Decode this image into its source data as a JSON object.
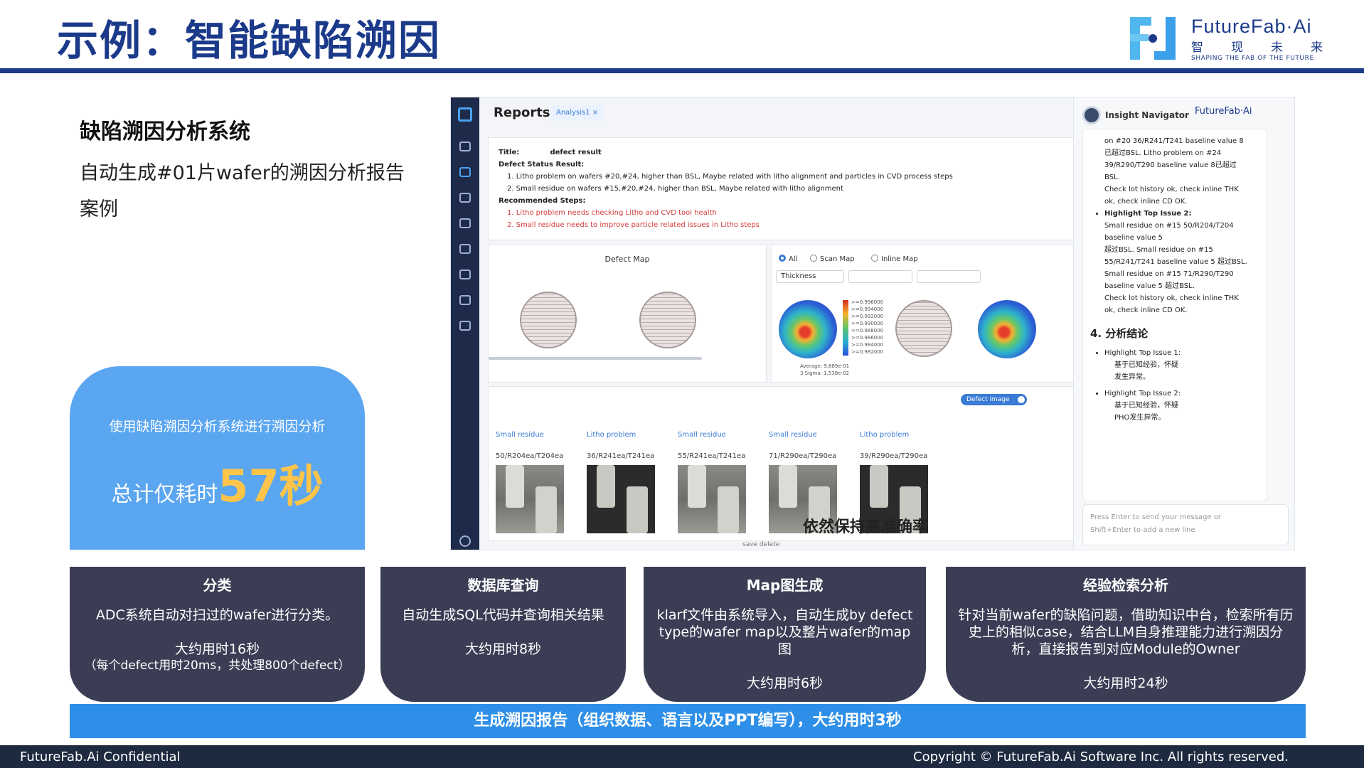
{
  "slide": {
    "title": "示例：智能缺陷溯因",
    "system_title": "缺陷溯因分析系统",
    "system_desc": "自动生成#01片wafer的溯因分析报告案例"
  },
  "logo": {
    "name": "FutureFab·Ai",
    "cn": [
      "智",
      "现",
      "未",
      "来"
    ],
    "tagline": "SHAPING THE FAB OF THE FUTURE"
  },
  "highlight": {
    "line1": "使用缺陷溯因分析系统进行溯因分析",
    "prefix": "总计仅耗时",
    "value": "57秒"
  },
  "app": {
    "title": "Reports",
    "tab": "Analysis1 ×",
    "report": {
      "title_label": "Title:",
      "title_value": "defect result",
      "status_header": "Defect Status Result:",
      "status_items": [
        "1. Litho problem on wafers #20,#24, higher than BSL, Maybe related with litho alignment and particles in CVD process steps",
        "2. Small residue on wafers #15,#20,#24, higher than BSL, Maybe related with litho alignment"
      ],
      "steps_header": "Recommended Steps:",
      "steps_items": [
        "1. Litho problem needs checking Litho and CVD tool health",
        "2. Small residue needs to improve particle related issues in Litho steps"
      ]
    },
    "defect_map_title": "Defect Map",
    "map_options": [
      "All",
      "Scan Map",
      "Inline Map"
    ],
    "thickness_select": "Thickness",
    "colorbar_labels": [
      ">=0.996000",
      ">=0.994000",
      ">=0.992000",
      ">=0.990000",
      ">=0.988000",
      ">=0.986000",
      ">=0.984000",
      ">=0.982000"
    ],
    "stats": [
      "Average: 9.889e-01",
      "3 Sigma: 1.538e-02"
    ],
    "defect_toggle": "Defect image",
    "defects": [
      {
        "type": "Small residue",
        "code": "50/R204ea/T204ea"
      },
      {
        "type": "Litho problem",
        "code": "36/R241ea/T241ea"
      },
      {
        "type": "Small residue",
        "code": "55/R241ea/T241ea"
      },
      {
        "type": "Small residue",
        "code": "71/R290ea/T290ea"
      },
      {
        "type": "Litho problem",
        "code": "39/R290ea/T290ea"
      }
    ],
    "overlay_caption": "依然保持高准确率",
    "actions": "save    delete",
    "navigator": {
      "title": "Insight Navigator",
      "logo": "FutureFab·Ai",
      "pre_lines": [
        "on #20 36/R241/T241 baseline value 8",
        "已超过BSL. Litho problem on #24",
        "39/R290/T290 baseline value 8已超过",
        "BSL.",
        "Check lot history ok, check inline THK",
        "ok, check inline CD OK."
      ],
      "issue2_label": "Highlight Top Issue 2:",
      "issue2_lines": [
        "Small residue on #15 50/R204/T204 baseline value 5",
        "超过BSL. Small residue on #15",
        "55/R241/T241 baseline value 5 超过BSL.",
        "Small residue on #15 71/R290/T290",
        "baseline value 5 超过BSL.",
        "Check lot history ok, check inline THK",
        "ok, check inline CD OK."
      ],
      "conclusion": "4. 分析结论",
      "c1": "Highlight Top Issue 1:",
      "c1_sub": [
        "基于已知经验，怀疑",
        "发生异常。"
      ],
      "c2": "Highlight Top Issue 2:",
      "c2_sub": [
        "基于已知经验，怀疑",
        "PHO发生异常。"
      ],
      "input_placeholder": [
        "Press Enter to send your message or",
        "Shift+Enter to add a new line"
      ]
    }
  },
  "steps": [
    {
      "title": "分类",
      "desc": "ADC系统自动对扫过的wafer进行分类。",
      "time": "大约用时16秒",
      "note": "（每个defect用时20ms，共处理800个defect）"
    },
    {
      "title": "数据库查询",
      "desc": "自动生成SQL代码并查询相关结果",
      "time": "大约用时8秒",
      "note": ""
    },
    {
      "title": "Map图生成",
      "desc": "klarf文件由系统导入，自动生成by defect type的wafer map以及整片wafer的map图",
      "time": "大约用时6秒",
      "note": ""
    },
    {
      "title": "经验检索分析",
      "desc": "针对当前wafer的缺陷问题，借助知识中台，检索所有历史上的相似case，结合LLM自身推理能力进行溯因分析，直接报告到对应Module的Owner",
      "time": "大约用时24秒",
      "note": ""
    }
  ],
  "bottom_bar": "生成溯因报告（组织数据、语言以及PPT编写），大约用时3秒",
  "footer": {
    "left": "FutureFab.Ai Confidential",
    "right": "Copyright © FutureFab.Ai Software Inc. All rights reserved."
  },
  "colors": {
    "brand": "#1b3a8a",
    "card_blue": "#5aa6f0",
    "step_bg": "#3b3d55",
    "accent": "#ffc54a",
    "bar_blue": "#2e8fe8"
  }
}
